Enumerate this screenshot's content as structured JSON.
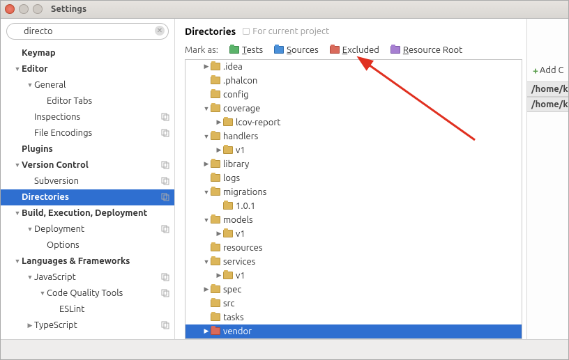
{
  "window": {
    "title": "Settings"
  },
  "search": {
    "value": "directo"
  },
  "sidebar": {
    "items": [
      {
        "label": "Keymap",
        "depth": 0,
        "bold": true,
        "arrow": "",
        "copy": false
      },
      {
        "label": "Editor",
        "depth": 0,
        "bold": true,
        "arrow": "▼",
        "copy": false
      },
      {
        "label": "General",
        "depth": 1,
        "bold": false,
        "arrow": "▼",
        "copy": false
      },
      {
        "label": "Editor Tabs",
        "depth": 2,
        "bold": false,
        "arrow": "",
        "copy": false
      },
      {
        "label": "Inspections",
        "depth": 1,
        "bold": false,
        "arrow": "",
        "copy": true
      },
      {
        "label": "File Encodings",
        "depth": 1,
        "bold": false,
        "arrow": "",
        "copy": true
      },
      {
        "label": "Plugins",
        "depth": 0,
        "bold": true,
        "arrow": "",
        "copy": false
      },
      {
        "label": "Version Control",
        "depth": 0,
        "bold": true,
        "arrow": "▼",
        "copy": true
      },
      {
        "label": "Subversion",
        "depth": 1,
        "bold": false,
        "arrow": "",
        "copy": true
      },
      {
        "label": "Directories",
        "depth": 0,
        "bold": true,
        "arrow": "",
        "copy": true,
        "selected": true
      },
      {
        "label": "Build, Execution, Deployment",
        "depth": 0,
        "bold": true,
        "arrow": "▼",
        "copy": false
      },
      {
        "label": "Deployment",
        "depth": 1,
        "bold": false,
        "arrow": "▼",
        "copy": true
      },
      {
        "label": "Options",
        "depth": 2,
        "bold": false,
        "arrow": "",
        "copy": false
      },
      {
        "label": "Languages & Frameworks",
        "depth": 0,
        "bold": true,
        "arrow": "▼",
        "copy": false
      },
      {
        "label": "JavaScript",
        "depth": 1,
        "bold": false,
        "arrow": "▼",
        "copy": true
      },
      {
        "label": "Code Quality Tools",
        "depth": 2,
        "bold": false,
        "arrow": "▼",
        "copy": true
      },
      {
        "label": "ESLint",
        "depth": 3,
        "bold": false,
        "arrow": "",
        "copy": false
      },
      {
        "label": "TypeScript",
        "depth": 1,
        "bold": false,
        "arrow": "▶",
        "copy": true
      }
    ]
  },
  "main": {
    "heading": "Directories",
    "subheading": "For current project",
    "mark_as_label": "Mark as:",
    "marks": [
      {
        "label": "Tests",
        "color": "f-green",
        "ul": "T",
        "rest": "ests"
      },
      {
        "label": "Sources",
        "color": "f-blue",
        "ul": "S",
        "rest": "ources"
      },
      {
        "label": "Excluded",
        "color": "f-red",
        "ul": "E",
        "rest": "xcluded"
      },
      {
        "label": "Resource Root",
        "color": "f-purple",
        "ul": "R",
        "rest": "esource Root"
      }
    ],
    "dirtree": [
      {
        "label": ".idea",
        "depth": 1,
        "arrow": "▶",
        "color": "f-yellow"
      },
      {
        "label": ".phalcon",
        "depth": 1,
        "arrow": "",
        "color": "f-yellow"
      },
      {
        "label": "config",
        "depth": 1,
        "arrow": "",
        "color": "f-yellow"
      },
      {
        "label": "coverage",
        "depth": 1,
        "arrow": "▼",
        "color": "f-yellow"
      },
      {
        "label": "lcov-report",
        "depth": 2,
        "arrow": "▶",
        "color": "f-yellow"
      },
      {
        "label": "handlers",
        "depth": 1,
        "arrow": "▼",
        "color": "f-yellow"
      },
      {
        "label": "v1",
        "depth": 2,
        "arrow": "▶",
        "color": "f-yellow"
      },
      {
        "label": "library",
        "depth": 1,
        "arrow": "▶",
        "color": "f-yellow"
      },
      {
        "label": "logs",
        "depth": 1,
        "arrow": "",
        "color": "f-yellow"
      },
      {
        "label": "migrations",
        "depth": 1,
        "arrow": "▼",
        "color": "f-yellow"
      },
      {
        "label": "1.0.1",
        "depth": 2,
        "arrow": "",
        "color": "f-yellow"
      },
      {
        "label": "models",
        "depth": 1,
        "arrow": "▼",
        "color": "f-yellow"
      },
      {
        "label": "v1",
        "depth": 2,
        "arrow": "▶",
        "color": "f-yellow"
      },
      {
        "label": "resources",
        "depth": 1,
        "arrow": "",
        "color": "f-yellow"
      },
      {
        "label": "services",
        "depth": 1,
        "arrow": "▼",
        "color": "f-yellow"
      },
      {
        "label": "v1",
        "depth": 2,
        "arrow": "▶",
        "color": "f-yellow"
      },
      {
        "label": "spec",
        "depth": 1,
        "arrow": "▶",
        "color": "f-yellow"
      },
      {
        "label": "src",
        "depth": 1,
        "arrow": "",
        "color": "f-yellow"
      },
      {
        "label": "tasks",
        "depth": 1,
        "arrow": "",
        "color": "f-yellow"
      },
      {
        "label": "vendor",
        "depth": 1,
        "arrow": "▶",
        "color": "f-red",
        "selected": true
      }
    ]
  },
  "right": {
    "add_label": "Add C",
    "paths": [
      "/home/k",
      "/home/k"
    ]
  }
}
